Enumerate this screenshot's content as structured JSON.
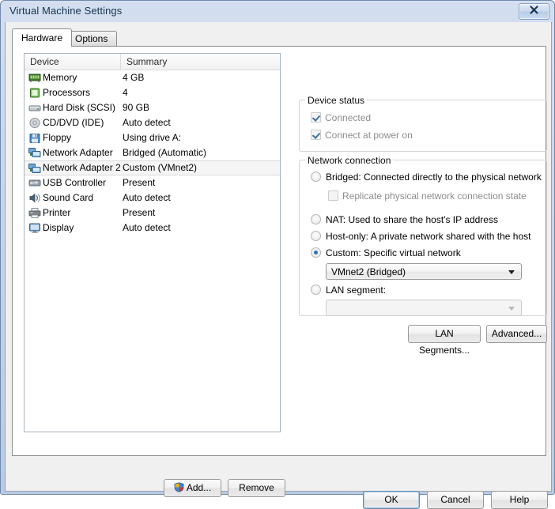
{
  "window": {
    "title": "Virtual Machine Settings",
    "close_glyph": "✖"
  },
  "tabs": [
    {
      "label": "Hardware",
      "active": true
    },
    {
      "label": "Options",
      "active": false
    }
  ],
  "device_list": {
    "columns": [
      "Device",
      "Summary"
    ],
    "rows": [
      {
        "icon": "memory-icon",
        "name": "Memory",
        "summary": "4 GB",
        "selected": false
      },
      {
        "icon": "processor-icon",
        "name": "Processors",
        "summary": "4",
        "selected": false
      },
      {
        "icon": "hard-disk-icon",
        "name": "Hard Disk (SCSI)",
        "summary": "90 GB",
        "selected": false
      },
      {
        "icon": "cd-dvd-icon",
        "name": "CD/DVD (IDE)",
        "summary": "Auto detect",
        "selected": false
      },
      {
        "icon": "floppy-icon",
        "name": "Floppy",
        "summary": "Using drive A:",
        "selected": false
      },
      {
        "icon": "network-adapter-icon",
        "name": "Network Adapter",
        "summary": "Bridged (Automatic)",
        "selected": false
      },
      {
        "icon": "network-adapter-icon",
        "name": "Network Adapter 2",
        "summary": "Custom (VMnet2)",
        "selected": true
      },
      {
        "icon": "usb-controller-icon",
        "name": "USB Controller",
        "summary": "Present",
        "selected": false
      },
      {
        "icon": "sound-card-icon",
        "name": "Sound Card",
        "summary": "Auto detect",
        "selected": false
      },
      {
        "icon": "printer-icon",
        "name": "Printer",
        "summary": "Present",
        "selected": false
      },
      {
        "icon": "display-icon",
        "name": "Display",
        "summary": "Auto detect",
        "selected": false
      }
    ],
    "add_label": "Add...",
    "remove_label": "Remove"
  },
  "device_status": {
    "legend": "Device status",
    "connected": {
      "label": "Connected",
      "checked": true,
      "enabled": false
    },
    "connect_at_power_on": {
      "label": "Connect at power on",
      "checked": true,
      "enabled": false
    }
  },
  "network_connection": {
    "legend": "Network connection",
    "options": [
      {
        "label": "Bridged: Connected directly to the physical network",
        "selected": false
      },
      {
        "label": "NAT: Used to share the host's IP address",
        "selected": false
      },
      {
        "label": "Host-only: A private network shared with the host",
        "selected": false
      },
      {
        "label": "Custom: Specific virtual network",
        "selected": true
      },
      {
        "label": "LAN segment:",
        "selected": false
      }
    ],
    "replicate": {
      "label": "Replicate physical network connection state",
      "checked": false,
      "enabled": false
    },
    "custom_combo": {
      "value": "VMnet2 (Bridged)",
      "enabled": true
    },
    "lan_segment_combo": {
      "value": "",
      "enabled": false
    },
    "lan_segments_button": "LAN Segments...",
    "advanced_button": "Advanced..."
  },
  "dialog_buttons": {
    "ok": "OK",
    "cancel": "Cancel",
    "help": "Help"
  },
  "colors": {
    "accent": "#2c73b8",
    "titlebar": "#c6d4ea",
    "selection": "#f5f5f5"
  }
}
